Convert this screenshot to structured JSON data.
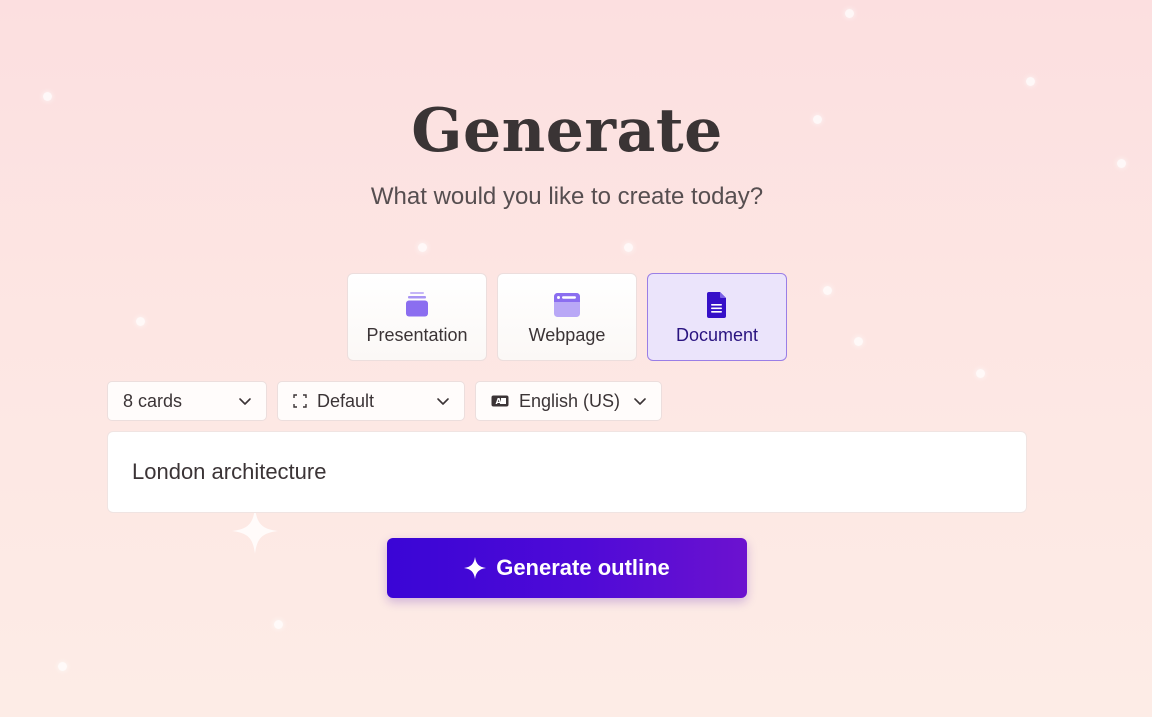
{
  "header": {
    "title": "Generate",
    "subtitle": "What would you like to create today?"
  },
  "content_types": [
    {
      "label": "Presentation",
      "icon": "presentation-stack-icon",
      "selected": false
    },
    {
      "label": "Webpage",
      "icon": "browser-window-icon",
      "selected": false
    },
    {
      "label": "Document",
      "icon": "document-icon",
      "selected": true
    }
  ],
  "options": {
    "cards": {
      "value": "8 cards",
      "icon": "chevron-down-icon"
    },
    "theme": {
      "value": "Default",
      "icon": "aspect-ratio-icon"
    },
    "language": {
      "value": "English (US)",
      "icon": "language-icon"
    }
  },
  "prompt": {
    "value": "London architecture"
  },
  "generate_button": {
    "label": "Generate outline",
    "icon": "sparkle-icon"
  },
  "colors": {
    "accent": "#4a0ad8",
    "selected_tile_bg": "#ebe4fb",
    "selected_tile_border": "#9a7ee6",
    "icon_purple": "#8b6ef0",
    "icon_dark": "#3610c8"
  }
}
